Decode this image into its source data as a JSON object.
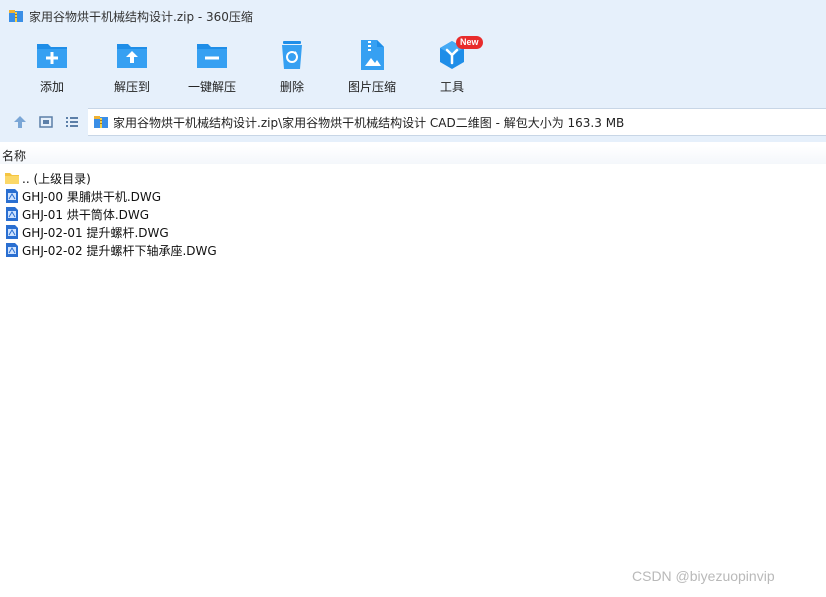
{
  "window": {
    "title": "家用谷物烘干机械结构设计.zip - 360压缩",
    "title_icon": "archive-icon"
  },
  "toolbar": {
    "items": [
      {
        "label": "添加",
        "icon": "add-folder-icon"
      },
      {
        "label": "解压到",
        "icon": "extract-to-icon"
      },
      {
        "label": "一键解压",
        "icon": "one-click-extract-icon"
      },
      {
        "label": "删除",
        "icon": "recycle-bin-icon"
      },
      {
        "label": "图片压缩",
        "icon": "image-compress-icon"
      },
      {
        "label": "工具",
        "icon": "tools-icon",
        "badge": "New"
      }
    ]
  },
  "address": {
    "path": "家用谷物烘干机械结构设计.zip\\家用谷物烘干机械结构设计 CAD二维图 - 解包大小为 163.3 MB"
  },
  "columns": {
    "name": "名称"
  },
  "files": [
    {
      "name": ".. (上级目录)",
      "type": "folder-up"
    },
    {
      "name": "GHJ-00 果脯烘干机.DWG",
      "type": "dwg"
    },
    {
      "name": "GHJ-01 烘干筒体.DWG",
      "type": "dwg"
    },
    {
      "name": "GHJ-02-01 提升螺杆.DWG",
      "type": "dwg"
    },
    {
      "name": "GHJ-02-02 提升螺杆下轴承座.DWG",
      "type": "dwg"
    }
  ],
  "watermark": "CSDN @biyezuopinvip",
  "colors": {
    "chrome_bg": "#e6f0fb",
    "icon_blue": "#1f8ee8",
    "badge_red": "#e82c2c"
  }
}
